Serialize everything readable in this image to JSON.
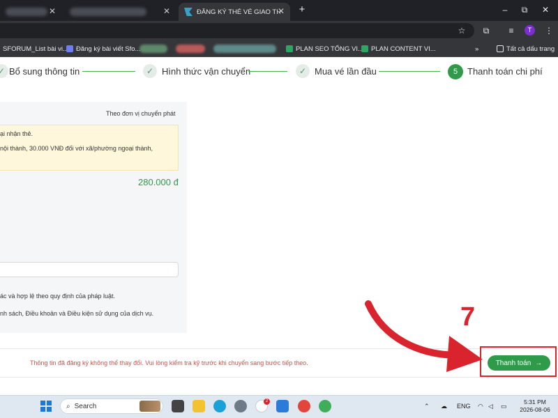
{
  "browser": {
    "active_tab_title": "ĐĂNG KÝ THẺ VÉ GIAO THÔNG",
    "tab_close_glyph": "✕",
    "new_tab_glyph": "+",
    "window_controls": [
      "–",
      "⧉",
      "✕"
    ],
    "profile_initial": "T",
    "bookmarks": [
      {
        "label": "SFORUM_List bài vi...",
        "icon": "bookmark-icon"
      },
      {
        "label": "Đăng ký bài viết Sfo...",
        "icon": "form-icon"
      },
      {
        "label": "PLAN SEO TỔNG VI...",
        "icon": "sheets-icon"
      },
      {
        "label": "PLAN CONTENT VI...",
        "icon": "sheets-icon"
      }
    ],
    "overflow_glyph": "»",
    "all_bookmarks_label": "Tất cả dấu trang"
  },
  "stepper": {
    "steps": [
      {
        "label": "Bổ sung thông tin",
        "state": "done"
      },
      {
        "label": "Hình thức vận chuyển",
        "state": "done"
      },
      {
        "label": "Mua vé lần đầu",
        "state": "done"
      },
      {
        "label": "Thanh toán chi phí",
        "state": "active",
        "number": "5"
      }
    ],
    "check_glyph": "✓"
  },
  "payment": {
    "delivery_label": "Theo đơn vị chuyển phát",
    "notice_lines": [
      "ại nhận thẻ.",
      "nội thành, 30.000 VNĐ đối với xã/phường ngoại thành,"
    ],
    "total": "280.000 đ",
    "legal_lines": [
      "ác và hợp lệ theo quy định của pháp luật.",
      "nh sách, Điều khoản và Điều kiện sử dụng của dịch vụ."
    ]
  },
  "footer": {
    "warning": "Thông tin đã đăng ký không thể thay đổi. Vui lòng kiểm tra kỹ trước khi chuyển sang bước tiếp theo.",
    "pay_button": "Thanh toán",
    "pay_button_arrow": "→"
  },
  "annotation": {
    "step_number": "7",
    "color": "#d9232d"
  },
  "taskbar": {
    "search_placeholder": "Search",
    "chat_badge": "2",
    "language": "ENG",
    "time": "5:31 PM",
    "date": "2026-08-06"
  },
  "colors": {
    "accent_green": "#2f9a4a",
    "warning_red": "#e04848"
  }
}
